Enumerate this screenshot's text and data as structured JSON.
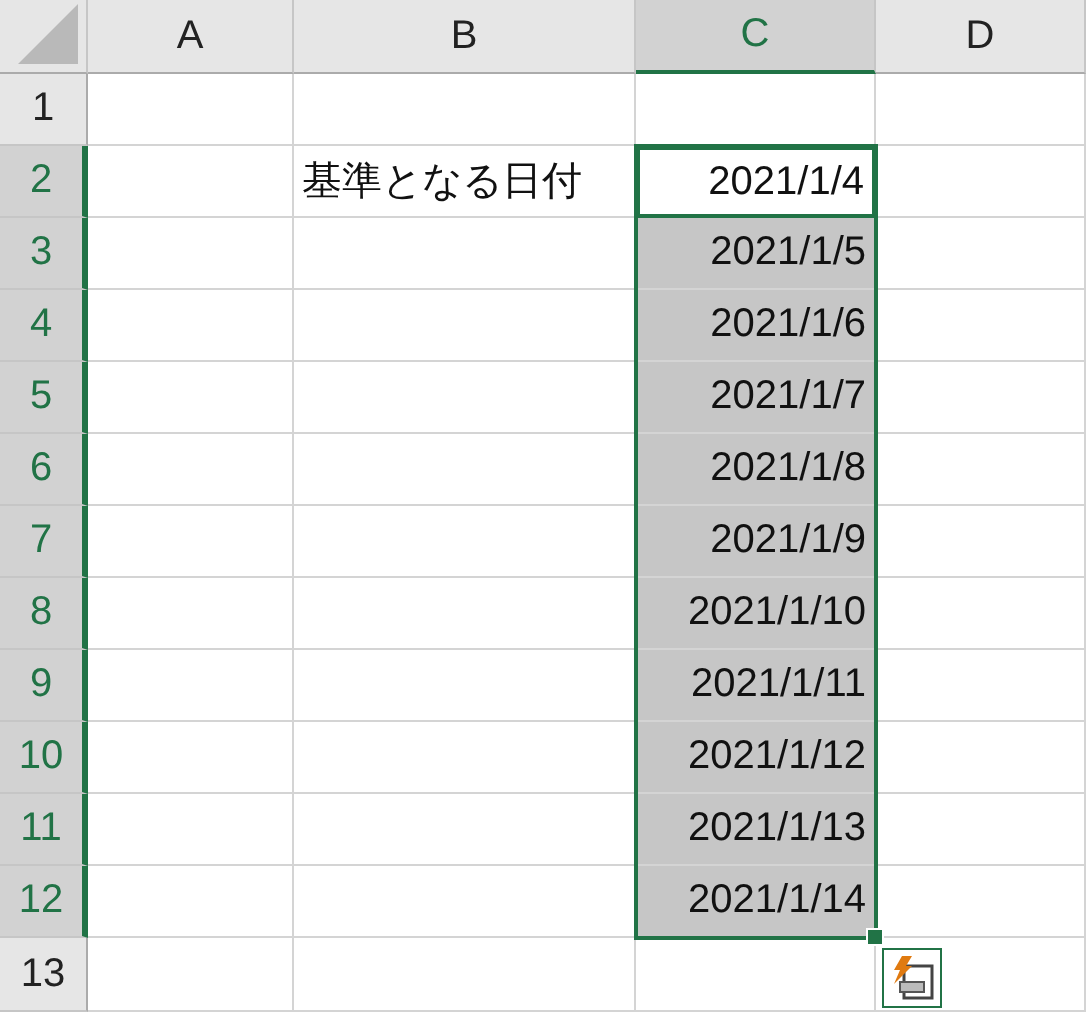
{
  "columns": [
    {
      "label": "A",
      "selected": false
    },
    {
      "label": "B",
      "selected": false
    },
    {
      "label": "C",
      "selected": true
    },
    {
      "label": "D",
      "selected": false
    }
  ],
  "rows": [
    {
      "label": "1",
      "selected": false,
      "cells": [
        {
          "selected": false,
          "active": false
        },
        {
          "selected": false,
          "active": false
        },
        {
          "selected": false,
          "active": false
        },
        {
          "selected": false,
          "active": false
        }
      ]
    },
    {
      "label": "2",
      "selected": true,
      "cells": [
        {
          "selected": false,
          "active": false
        },
        {
          "text": "基準となる日付",
          "kind": "text",
          "selected": false,
          "active": false
        },
        {
          "text": "2021/1/4",
          "kind": "date",
          "selected": false,
          "active": true
        },
        {
          "selected": false,
          "active": false
        }
      ]
    },
    {
      "label": "3",
      "selected": true,
      "cells": [
        {
          "selected": false,
          "active": false
        },
        {
          "selected": false,
          "active": false
        },
        {
          "text": "2021/1/5",
          "kind": "date",
          "selected": true,
          "active": false
        },
        {
          "selected": false,
          "active": false
        }
      ]
    },
    {
      "label": "4",
      "selected": true,
      "cells": [
        {
          "selected": false,
          "active": false
        },
        {
          "selected": false,
          "active": false
        },
        {
          "text": "2021/1/6",
          "kind": "date",
          "selected": true,
          "active": false
        },
        {
          "selected": false,
          "active": false
        }
      ]
    },
    {
      "label": "5",
      "selected": true,
      "cells": [
        {
          "selected": false,
          "active": false
        },
        {
          "selected": false,
          "active": false
        },
        {
          "text": "2021/1/7",
          "kind": "date",
          "selected": true,
          "active": false
        },
        {
          "selected": false,
          "active": false
        }
      ]
    },
    {
      "label": "6",
      "selected": true,
      "cells": [
        {
          "selected": false,
          "active": false
        },
        {
          "selected": false,
          "active": false
        },
        {
          "text": "2021/1/8",
          "kind": "date",
          "selected": true,
          "active": false
        },
        {
          "selected": false,
          "active": false
        }
      ]
    },
    {
      "label": "7",
      "selected": true,
      "cells": [
        {
          "selected": false,
          "active": false
        },
        {
          "selected": false,
          "active": false
        },
        {
          "text": "2021/1/9",
          "kind": "date",
          "selected": true,
          "active": false
        },
        {
          "selected": false,
          "active": false
        }
      ]
    },
    {
      "label": "8",
      "selected": true,
      "cells": [
        {
          "selected": false,
          "active": false
        },
        {
          "selected": false,
          "active": false
        },
        {
          "text": "2021/1/10",
          "kind": "date",
          "selected": true,
          "active": false
        },
        {
          "selected": false,
          "active": false
        }
      ]
    },
    {
      "label": "9",
      "selected": true,
      "cells": [
        {
          "selected": false,
          "active": false
        },
        {
          "selected": false,
          "active": false
        },
        {
          "text": "2021/1/11",
          "kind": "date",
          "selected": true,
          "active": false
        },
        {
          "selected": false,
          "active": false
        }
      ]
    },
    {
      "label": "10",
      "selected": true,
      "cells": [
        {
          "selected": false,
          "active": false
        },
        {
          "selected": false,
          "active": false
        },
        {
          "text": "2021/1/12",
          "kind": "date",
          "selected": true,
          "active": false
        },
        {
          "selected": false,
          "active": false
        }
      ]
    },
    {
      "label": "11",
      "selected": true,
      "cells": [
        {
          "selected": false,
          "active": false
        },
        {
          "selected": false,
          "active": false
        },
        {
          "text": "2021/1/13",
          "kind": "date",
          "selected": true,
          "active": false
        },
        {
          "selected": false,
          "active": false
        }
      ]
    },
    {
      "label": "12",
      "selected": true,
      "cells": [
        {
          "selected": false,
          "active": false
        },
        {
          "selected": false,
          "active": false
        },
        {
          "text": "2021/1/14",
          "kind": "date",
          "selected": true,
          "active": false
        },
        {
          "selected": false,
          "active": false
        }
      ]
    },
    {
      "label": "13",
      "selected": false,
      "cells": [
        {
          "selected": false,
          "active": false
        },
        {
          "selected": false,
          "active": false
        },
        {
          "selected": false,
          "active": false
        },
        {
          "selected": false,
          "active": false
        }
      ]
    }
  ]
}
